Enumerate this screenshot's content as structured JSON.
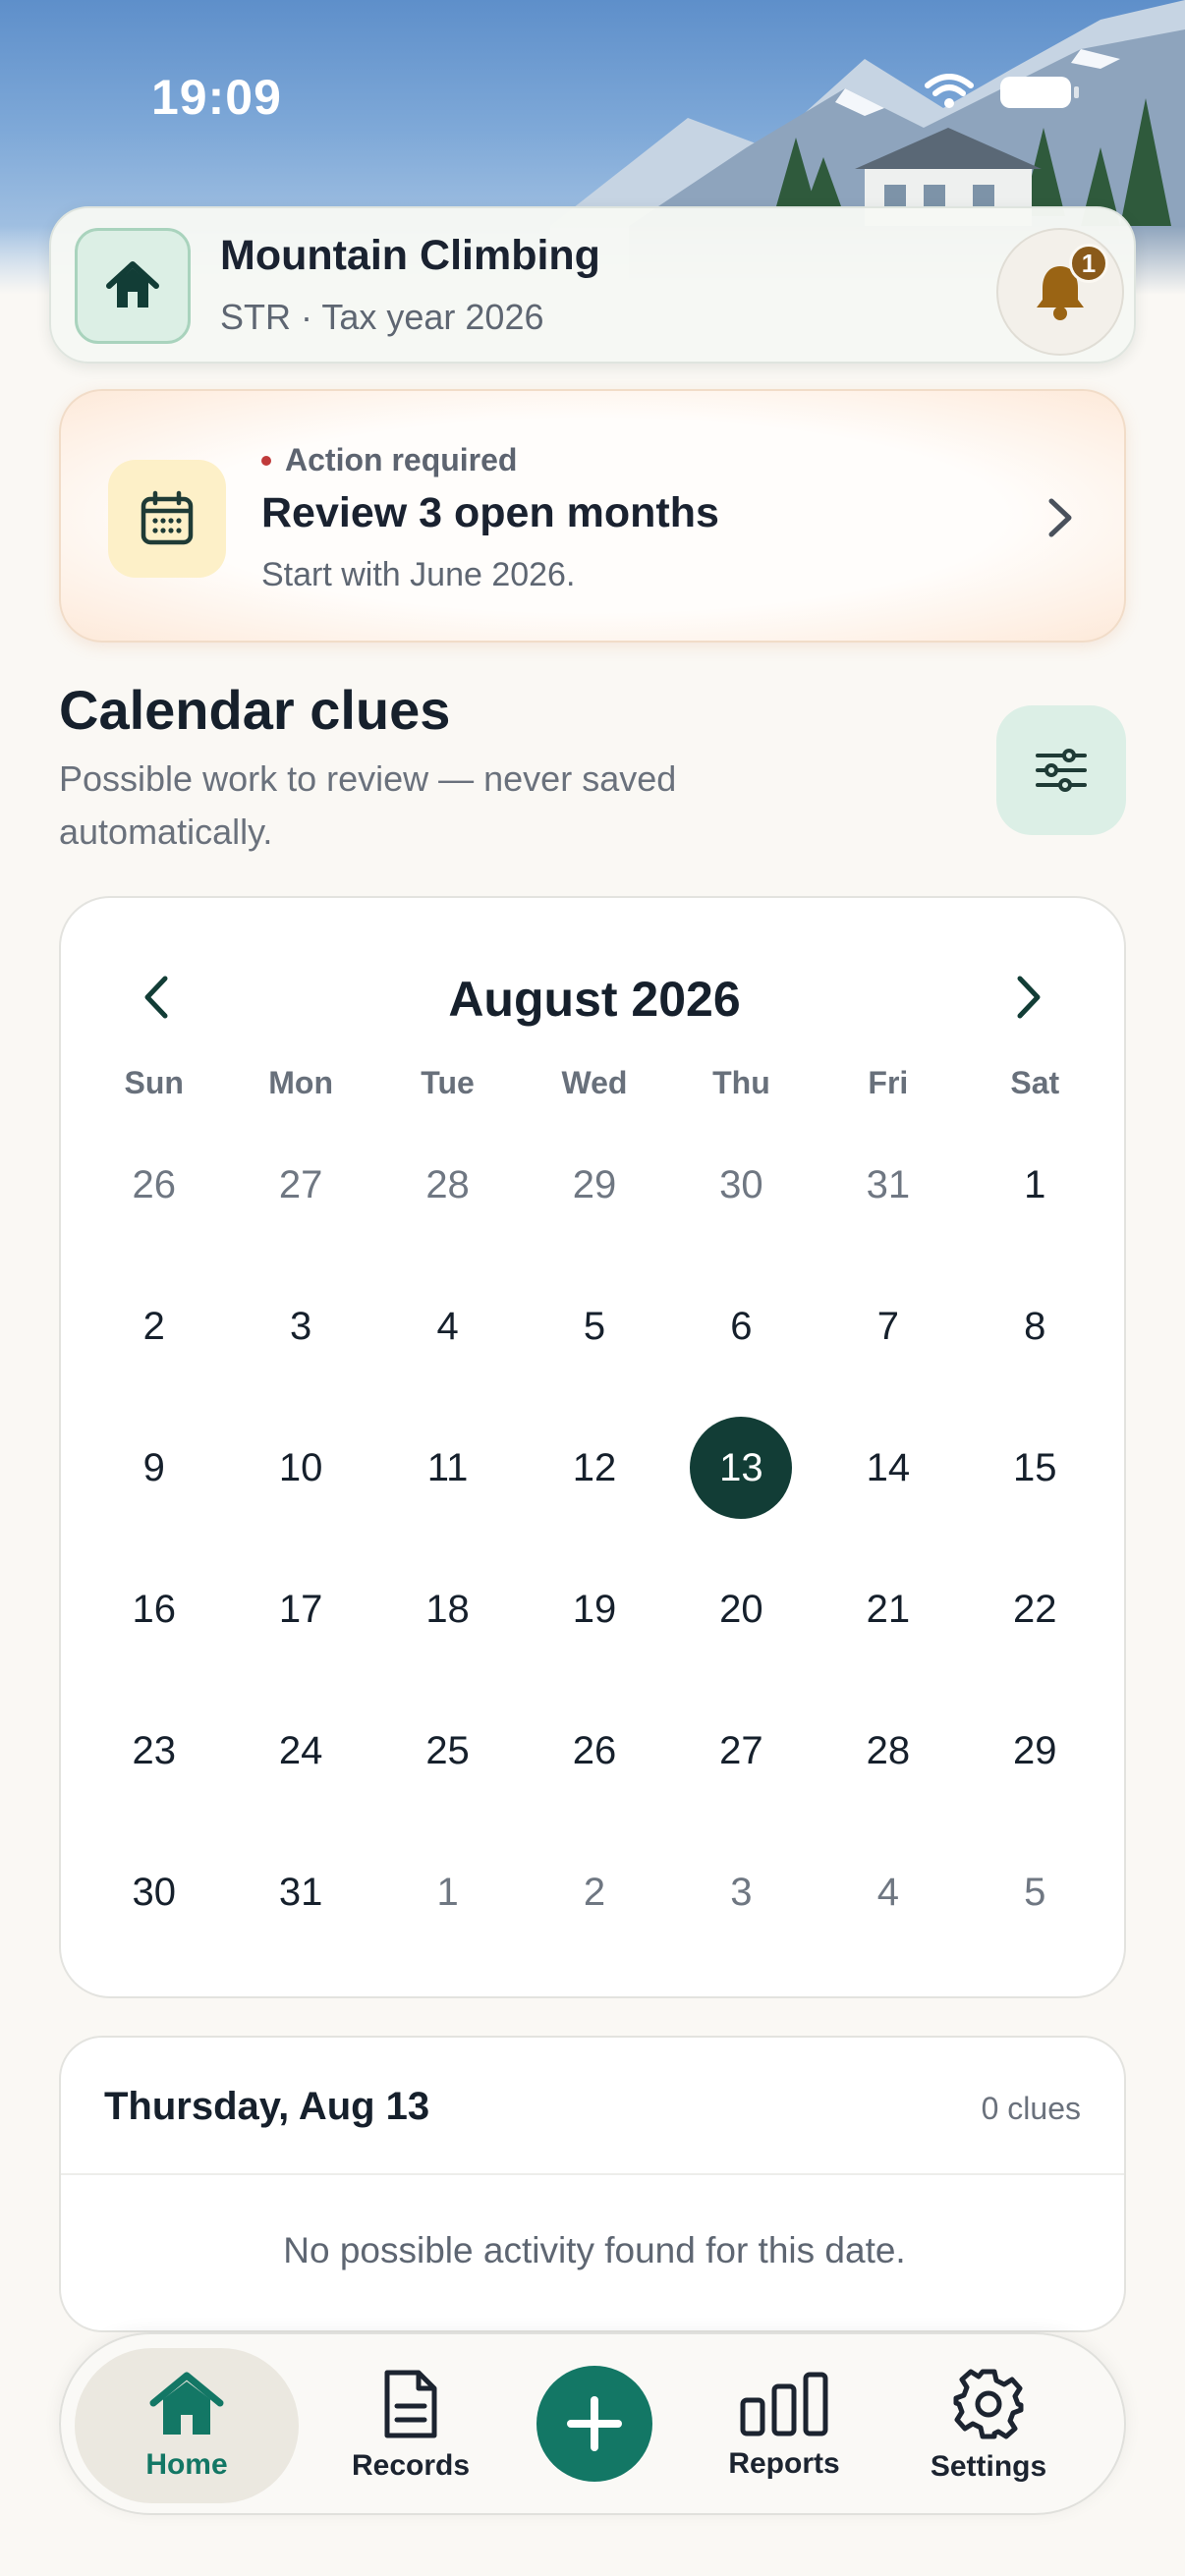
{
  "status_bar": {
    "time": "19:09"
  },
  "header": {
    "title": "Mountain Climbing",
    "subtitle": "STR · Tax year 2026",
    "notification_count": "1"
  },
  "action_card": {
    "kicker": "Action required",
    "title": "Review 3 open months",
    "subtitle": "Start with June 2026."
  },
  "section": {
    "title": "Calendar clues",
    "subtitle": "Possible work to review — never saved automatically."
  },
  "calendar": {
    "month_label": "August 2026",
    "weekdays": [
      "Sun",
      "Mon",
      "Tue",
      "Wed",
      "Thu",
      "Fri",
      "Sat"
    ],
    "days": [
      {
        "label": "26",
        "in_month": false
      },
      {
        "label": "27",
        "in_month": false
      },
      {
        "label": "28",
        "in_month": false
      },
      {
        "label": "29",
        "in_month": false
      },
      {
        "label": "30",
        "in_month": false
      },
      {
        "label": "31",
        "in_month": false
      },
      {
        "label": "1",
        "in_month": true
      },
      {
        "label": "2",
        "in_month": true
      },
      {
        "label": "3",
        "in_month": true
      },
      {
        "label": "4",
        "in_month": true
      },
      {
        "label": "5",
        "in_month": true
      },
      {
        "label": "6",
        "in_month": true
      },
      {
        "label": "7",
        "in_month": true
      },
      {
        "label": "8",
        "in_month": true
      },
      {
        "label": "9",
        "in_month": true
      },
      {
        "label": "10",
        "in_month": true
      },
      {
        "label": "11",
        "in_month": true
      },
      {
        "label": "12",
        "in_month": true
      },
      {
        "label": "13",
        "in_month": true,
        "selected": true
      },
      {
        "label": "14",
        "in_month": true
      },
      {
        "label": "15",
        "in_month": true
      },
      {
        "label": "16",
        "in_month": true
      },
      {
        "label": "17",
        "in_month": true
      },
      {
        "label": "18",
        "in_month": true
      },
      {
        "label": "19",
        "in_month": true
      },
      {
        "label": "20",
        "in_month": true
      },
      {
        "label": "21",
        "in_month": true
      },
      {
        "label": "22",
        "in_month": true
      },
      {
        "label": "23",
        "in_month": true
      },
      {
        "label": "24",
        "in_month": true
      },
      {
        "label": "25",
        "in_month": true
      },
      {
        "label": "26",
        "in_month": true
      },
      {
        "label": "27",
        "in_month": true
      },
      {
        "label": "28",
        "in_month": true
      },
      {
        "label": "29",
        "in_month": true
      },
      {
        "label": "30",
        "in_month": true
      },
      {
        "label": "31",
        "in_month": true
      },
      {
        "label": "1",
        "in_month": false
      },
      {
        "label": "2",
        "in_month": false
      },
      {
        "label": "3",
        "in_month": false
      },
      {
        "label": "4",
        "in_month": false
      },
      {
        "label": "5",
        "in_month": false
      }
    ]
  },
  "day_detail": {
    "date_label": "Thursday, Aug 13",
    "clue_count": "0 clues",
    "empty_message": "No possible activity found for this date."
  },
  "tabbar": {
    "home": "Home",
    "records": "Records",
    "reports": "Reports",
    "settings": "Settings"
  },
  "colors": {
    "brand_green": "#137765",
    "selected_day": "#123d36",
    "badge": "#8a5a1a",
    "alert_dot": "#c03a3a"
  },
  "icons": [
    "house-icon",
    "bell-icon",
    "calendar-icon",
    "chevron-right-icon",
    "filter-sliders-icon",
    "chevron-left-icon",
    "document-icon",
    "plus-icon",
    "bar-chart-icon",
    "gear-icon",
    "wifi-icon",
    "battery-icon"
  ]
}
